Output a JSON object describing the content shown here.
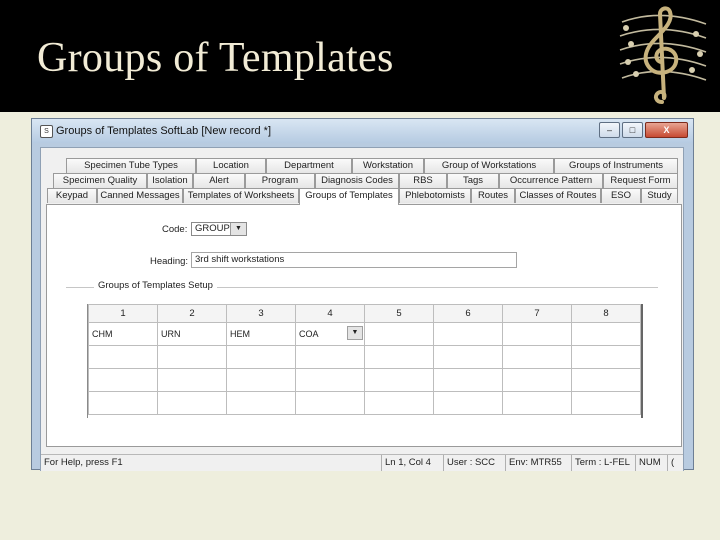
{
  "slide": {
    "title": "Groups of Templates"
  },
  "window": {
    "app_icon": "S",
    "title": "Groups of Templates   SoftLab   [New record *]",
    "min_label": "–",
    "max_label": "□",
    "close_label": "X"
  },
  "tabs": {
    "row1": [
      "Specimen Tube Types",
      "Location",
      "Department",
      "Workstation",
      "Group of Workstations",
      "Groups of Instruments"
    ],
    "row2": [
      "Specimen Quality",
      "Isolation",
      "Alert",
      "Program",
      "Diagnosis Codes",
      "RBS",
      "Tags",
      "Occurrence Pattern",
      "Request Form"
    ],
    "row3": [
      "Keypad",
      "Canned Messages",
      "Templates of Worksheets",
      "Groups of Templates",
      "Phlebotomists",
      "Routes",
      "Classes of Routes",
      "ESO",
      "Study"
    ],
    "active": "Groups of Templates"
  },
  "form": {
    "code_label": "Code:",
    "code_value": "GROUP",
    "heading_label": "Heading:",
    "heading_value": "3rd shift workstations",
    "group_title": "Groups of Templates Setup"
  },
  "grid": {
    "headers": [
      "1",
      "2",
      "3",
      "4",
      "5",
      "6",
      "7",
      "8"
    ],
    "rows": [
      [
        "CHM",
        "URN",
        "HEM",
        "COA",
        "",
        "",
        "",
        ""
      ],
      [
        "",
        "",
        "",
        "",
        "",
        "",
        "",
        ""
      ],
      [
        "",
        "",
        "",
        "",
        "",
        "",
        "",
        ""
      ],
      [
        "",
        "",
        "",
        "",
        "",
        "",
        "",
        ""
      ]
    ],
    "combo_cell": "row0-col3"
  },
  "status": {
    "help": "For Help, press F1",
    "position": "Ln 1, Col 4",
    "user": "User : SCC",
    "env": "Env: MTR55",
    "term": "Term : L-FEL",
    "num": "NUM",
    "extra": "("
  },
  "colors": {
    "header_bg": "#000000",
    "title_text": "#f2ecd6",
    "slide_bg": "#eeeedd",
    "window_frame": "#b8cbe0",
    "logo_gold": "#c7b27d"
  },
  "icons": {
    "logo": "treble-clef-music-staff-icon",
    "combo_arrow": "dropdown-arrow-icon"
  }
}
